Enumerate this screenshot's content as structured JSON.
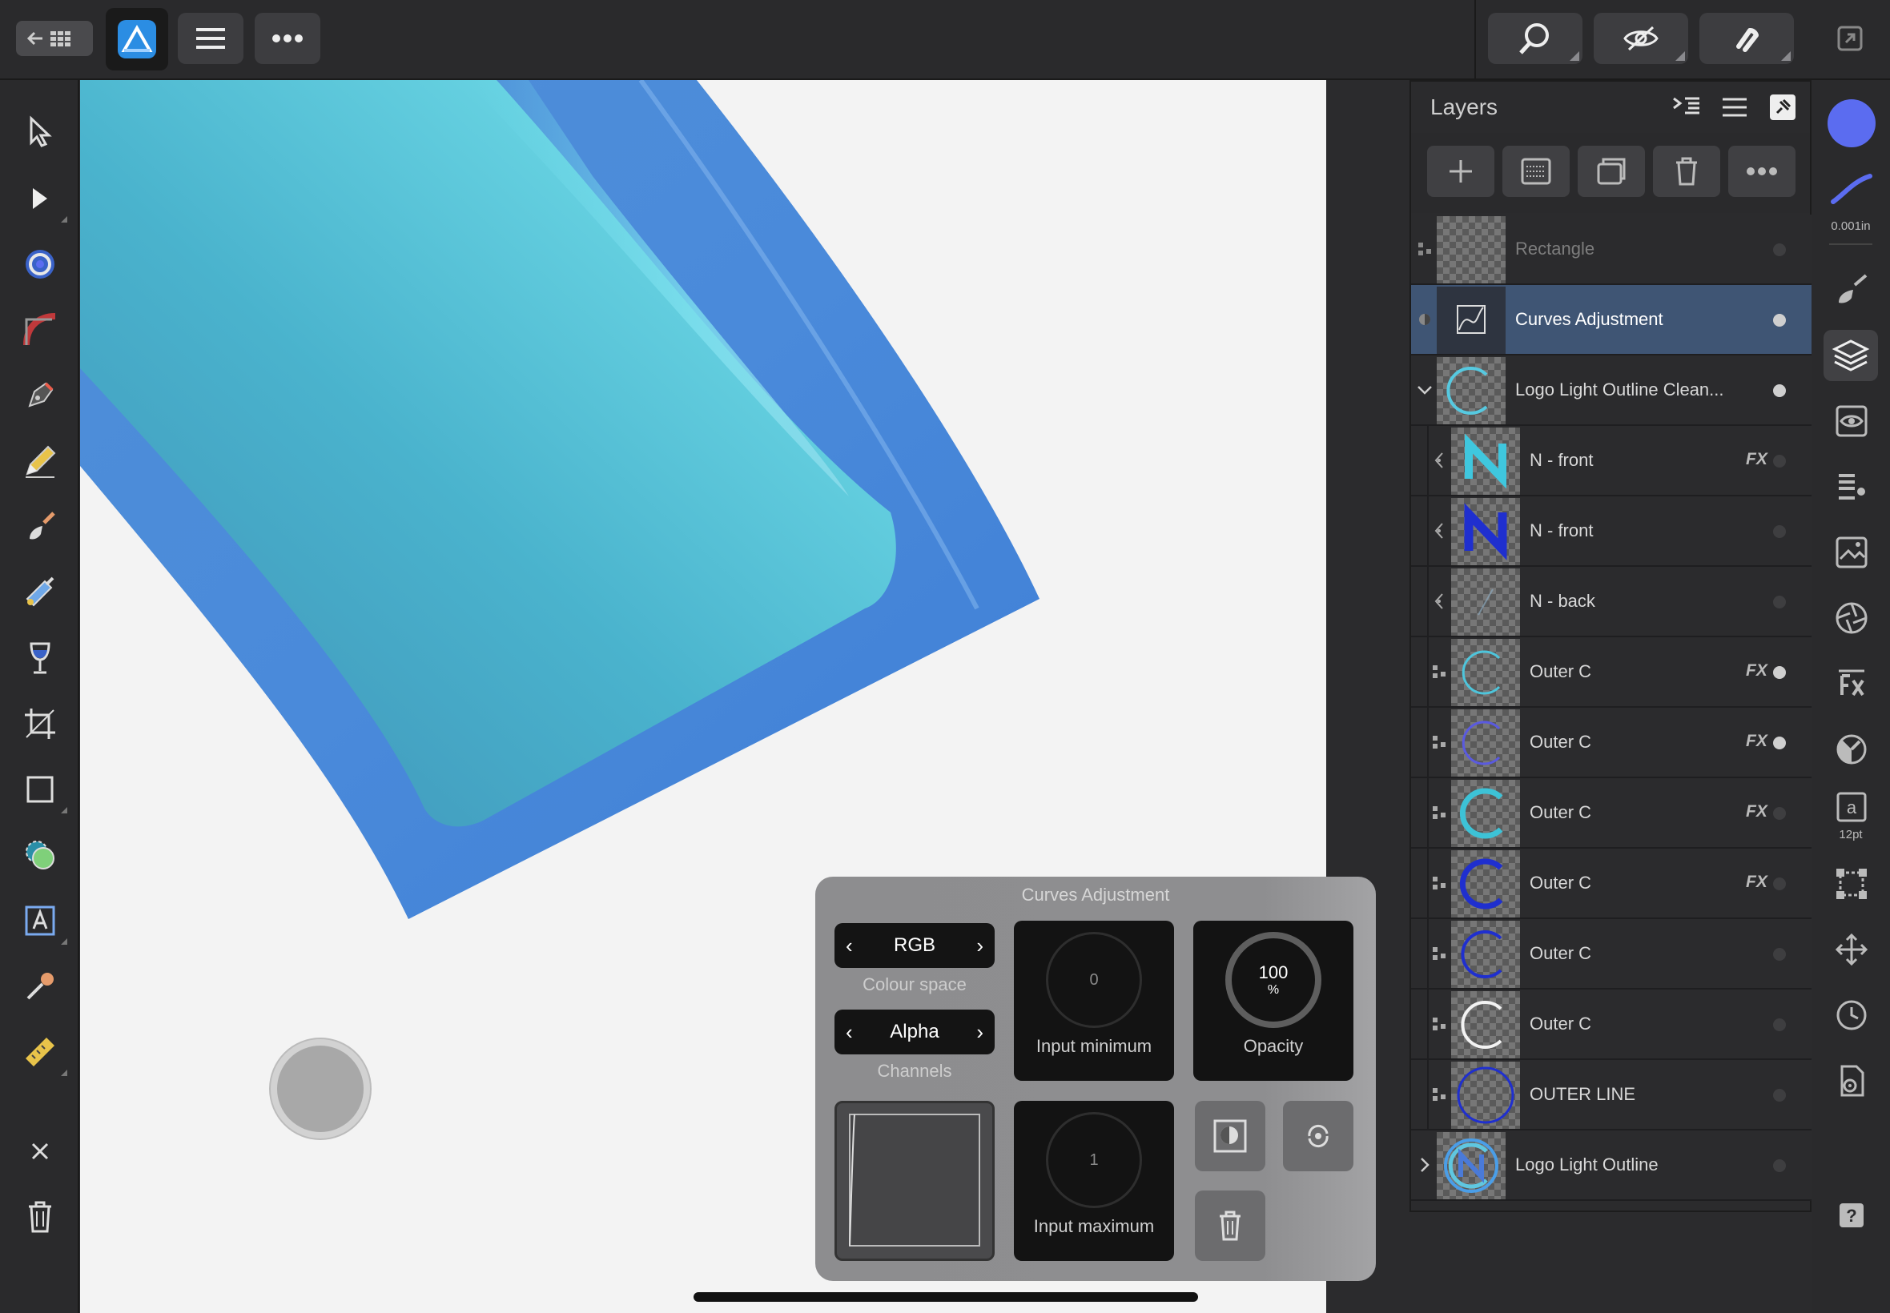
{
  "layers_panel": {
    "title": "Layers",
    "rows": [
      {
        "name": "Rectangle",
        "fx": "",
        "visible": false
      },
      {
        "name": "Curves Adjustment",
        "fx": "",
        "visible": true,
        "selected": true
      },
      {
        "name": "Logo Light Outline Clean...",
        "fx": "",
        "visible": true,
        "expanded": true
      },
      {
        "name": "N - front",
        "fx": "FX",
        "visible": false
      },
      {
        "name": "N - front",
        "fx": "",
        "visible": false
      },
      {
        "name": "N - back",
        "fx": "",
        "visible": false
      },
      {
        "name": "Outer C",
        "fx": "FX",
        "visible": true
      },
      {
        "name": "Outer C",
        "fx": "FX",
        "visible": true
      },
      {
        "name": "Outer C",
        "fx": "FX",
        "visible": false
      },
      {
        "name": "Outer C",
        "fx": "FX",
        "visible": false
      },
      {
        "name": "Outer C",
        "fx": "",
        "visible": false
      },
      {
        "name": "Outer C",
        "fx": "",
        "visible": false
      },
      {
        "name": "OUTER LINE",
        "fx": "",
        "visible": false
      },
      {
        "name": "Logo Light Outline",
        "fx": "",
        "visible": false,
        "collapsed": true
      }
    ]
  },
  "curves": {
    "title": "Curves Adjustment",
    "colour_space_value": "RGB",
    "colour_space_label": "Colour space",
    "channels_value": "Alpha",
    "channels_label": "Channels",
    "input_min_value": "0",
    "input_min_label": "Input minimum",
    "opacity_value": "100",
    "opacity_unit": "%",
    "opacity_label": "Opacity",
    "input_max_value": "1",
    "input_max_label": "Input maximum"
  },
  "right_bar": {
    "stroke_width": "0.001in",
    "font_size": "12pt",
    "text_icon_glyph": "a",
    "help_glyph": "?"
  },
  "colors": {
    "accent": "#5b6cf0",
    "selection": "#3f5574"
  }
}
